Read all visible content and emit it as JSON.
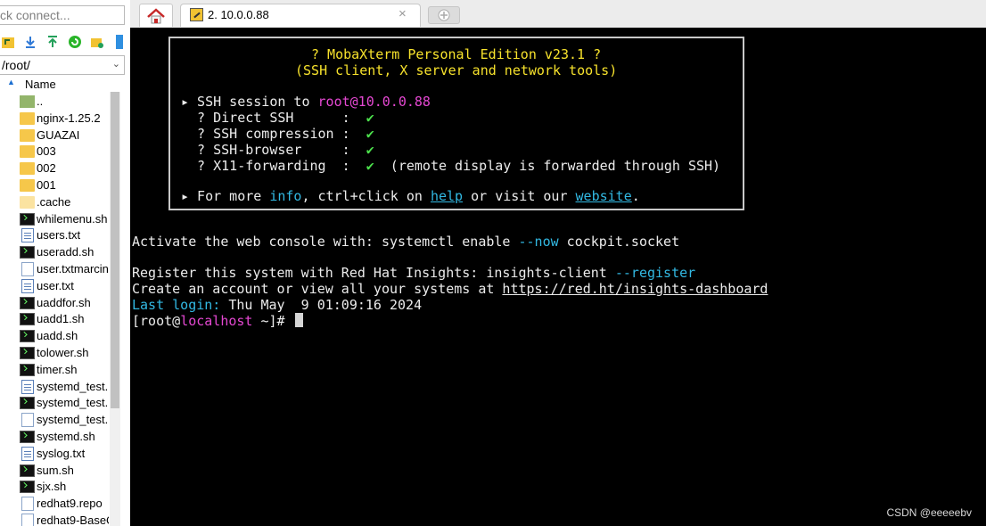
{
  "sidebar": {
    "quick_connect": "ck connect...",
    "path": "/root/",
    "column_header": "Name",
    "files": [
      {
        "name": "..",
        "type": "folder-up"
      },
      {
        "name": "nginx-1.25.2",
        "type": "folder"
      },
      {
        "name": "GUAZAI",
        "type": "folder"
      },
      {
        "name": "003",
        "type": "folder"
      },
      {
        "name": "002",
        "type": "folder"
      },
      {
        "name": "001",
        "type": "folder"
      },
      {
        "name": ".cache",
        "type": "folder-light"
      },
      {
        "name": "whilemenu.sh",
        "type": "sh"
      },
      {
        "name": "users.txt",
        "type": "txt"
      },
      {
        "name": "useradd.sh",
        "type": "sh"
      },
      {
        "name": "user.txtmarcin",
        "type": "file"
      },
      {
        "name": "user.txt",
        "type": "txt"
      },
      {
        "name": "uaddfor.sh",
        "type": "sh"
      },
      {
        "name": "uadd1.sh",
        "type": "sh"
      },
      {
        "name": "uadd.sh",
        "type": "sh"
      },
      {
        "name": "tolower.sh",
        "type": "sh"
      },
      {
        "name": "timer.sh",
        "type": "sh"
      },
      {
        "name": "systemd_test.",
        "type": "txt"
      },
      {
        "name": "systemd_test.",
        "type": "sh"
      },
      {
        "name": "systemd_test.",
        "type": "file"
      },
      {
        "name": "systemd.sh",
        "type": "sh"
      },
      {
        "name": "syslog.txt",
        "type": "txt"
      },
      {
        "name": "sum.sh",
        "type": "sh"
      },
      {
        "name": "sjx.sh",
        "type": "sh"
      },
      {
        "name": "redhat9.repo",
        "type": "file"
      },
      {
        "name": "redhat9-BaseC",
        "type": "file"
      }
    ]
  },
  "tabs": {
    "session_label": "2. 10.0.0.88"
  },
  "terminal": {
    "banner": {
      "title": "? MobaXterm Personal Edition v23.1 ?",
      "subtitle": "(SSH client, X server and network tools)",
      "session_prefix": "▸ SSH session to ",
      "session_host": "root@10.0.0.88",
      "items": [
        {
          "label": "  ? Direct SSH      :  ",
          "check": "✔",
          "note": ""
        },
        {
          "label": "  ? SSH compression :  ",
          "check": "✔",
          "note": ""
        },
        {
          "label": "  ? SSH-browser     :  ",
          "check": "✔",
          "note": ""
        },
        {
          "label": "  ? X11-forwarding  :  ",
          "check": "✔",
          "note": "  (remote display is forwarded through SSH)"
        }
      ],
      "more_prefix": "▸ For more ",
      "more_info": "info",
      "more_mid": ", ctrl+click on ",
      "more_help": "help",
      "more_mid2": " or visit our ",
      "more_website": "website",
      "more_end": "."
    },
    "activate_prefix": "Activate the web console with: systemctl enable ",
    "activate_flag": "--now",
    "activate_end": " cockpit.socket",
    "register_prefix": "Register this system with Red Hat Insights: insights-client ",
    "register_flag": "--register",
    "account_prefix": "Create an account or view all your systems at ",
    "account_url": "https://red.ht/insights-dashboard",
    "lastlogin_label": "Last login:",
    "lastlogin_value": " Thu May  9 01:09:16 2024",
    "prompt_open": "[root@",
    "prompt_host": "localhost",
    "prompt_close": " ~]# "
  },
  "watermark": "CSDN @eeeeebv",
  "colors": {
    "yellow": "#f7e22c",
    "magenta": "#e548d2",
    "green": "#4ce04c",
    "cyan": "#32b9e3"
  }
}
